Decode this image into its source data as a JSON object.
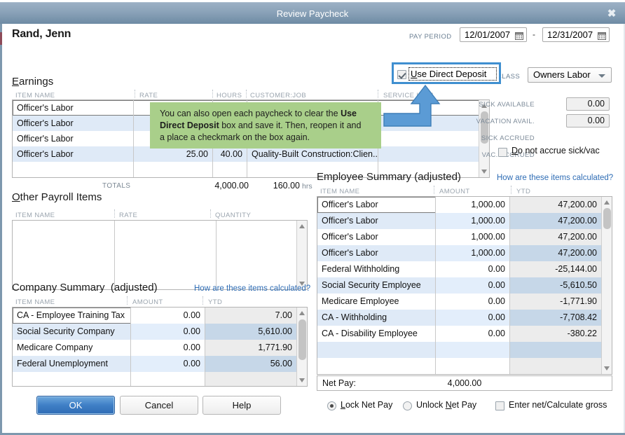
{
  "window": {
    "title": "Review Paycheck",
    "close_icon": "close-icon"
  },
  "header": {
    "employee_name": "Rand, Jenn",
    "pay_period_label": "PAY PERIOD",
    "pay_period_start": "12/01/2007",
    "pay_period_end": "12/31/2007",
    "date_separator": "-",
    "class_label": "CLASS",
    "class_value": "Owners Labor",
    "direct_deposit_label_1": "U",
    "direct_deposit_label_2": "se Direct Deposit",
    "direct_deposit_checked": true
  },
  "callout": {
    "line1_a": "You can also open each paycheck to clear the ",
    "line1_b": "Use",
    "line2_a": "Direct Deposit",
    "line2_b": " box and save it. Then, reopen it and",
    "line3": "a place a checkmark on the box again."
  },
  "earnings": {
    "title_accel": "E",
    "title_rest": "arnings",
    "columns": [
      "ITEM NAME",
      "RATE",
      "HOURS",
      "CUSTOMER:JOB",
      "SERVICE ITEM"
    ],
    "rows": [
      {
        "item": "Officer's Labor",
        "rate": "",
        "hours": "",
        "customer_job": "",
        "service_item": ""
      },
      {
        "item": "Officer's Labor",
        "rate": "",
        "hours": "",
        "customer_job": "",
        "service_item": ""
      },
      {
        "item": "Officer's Labor",
        "rate": "",
        "hours": "",
        "customer_job": "",
        "service_item": ""
      },
      {
        "item": "Officer's Labor",
        "rate": "25.00",
        "hours": "40.00",
        "customer_job": "Quality-Built Construction:Clien...",
        "service_item": ""
      },
      {
        "item": "",
        "rate": "",
        "hours": "",
        "customer_job": "",
        "service_item": ""
      }
    ],
    "totals_label": "TOTALS",
    "totals_rate": "4,000.00",
    "totals_hours": "160.00",
    "totals_hours_unit": "hrs"
  },
  "leave_info": {
    "sick_available_label": "SICK AVAILABLE",
    "sick_available_value": "0.00",
    "vacation_avail_label": "VACATION AVAIL.",
    "vacation_avail_value": "0.00",
    "sick_accrued_label": "SICK ACCRUED",
    "vac_accrued_label": "VAC. ACCRUED",
    "do_not_accrue_accel": "D",
    "do_not_accrue_rest": "o not accrue sick/vac",
    "do_not_accrue_checked": false
  },
  "other_payroll": {
    "title_accel": "O",
    "title_rest": "ther Payroll Items",
    "columns": [
      "ITEM NAME",
      "RATE",
      "QUANTITY"
    ],
    "rows": []
  },
  "company_summary": {
    "title": "Company Summary",
    "title_suffix": "(adjusted)",
    "help_link": "How are these items calculated?",
    "columns": [
      "ITEM NAME",
      "AMOUNT",
      "YTD"
    ],
    "rows": [
      {
        "item": "CA - Employee Training Tax",
        "amount": "0.00",
        "ytd": "7.00"
      },
      {
        "item": "Social Security Company",
        "amount": "0.00",
        "ytd": "5,610.00"
      },
      {
        "item": "Medicare Company",
        "amount": "0.00",
        "ytd": "1,771.90"
      },
      {
        "item": "Federal Unemployment",
        "amount": "0.00",
        "ytd": "56.00"
      },
      {
        "item": "",
        "amount": "",
        "ytd": ""
      }
    ]
  },
  "employee_summary": {
    "title": "Employee Summary",
    "title_suffix": "(adjusted)",
    "help_link": "How are these items calculated?",
    "columns": [
      "ITEM NAME",
      "AMOUNT",
      "YTD"
    ],
    "rows": [
      {
        "item": "Officer's Labor",
        "amount": "1,000.00",
        "ytd": "47,200.00"
      },
      {
        "item": "Officer's Labor",
        "amount": "1,000.00",
        "ytd": "47,200.00"
      },
      {
        "item": "Officer's Labor",
        "amount": "1,000.00",
        "ytd": "47,200.00"
      },
      {
        "item": "Officer's Labor",
        "amount": "1,000.00",
        "ytd": "47,200.00"
      },
      {
        "item": "Federal Withholding",
        "amount": "0.00",
        "ytd": "-25,144.00"
      },
      {
        "item": "Social Security Employee",
        "amount": "0.00",
        "ytd": "-5,610.50"
      },
      {
        "item": "Medicare Employee",
        "amount": "0.00",
        "ytd": "-1,771.90"
      },
      {
        "item": "CA - Withholding",
        "amount": "0.00",
        "ytd": "-7,708.42"
      },
      {
        "item": "CA - Disability Employee",
        "amount": "0.00",
        "ytd": "-380.22"
      },
      {
        "item": "",
        "amount": "",
        "ytd": ""
      },
      {
        "item": "",
        "amount": "",
        "ytd": ""
      }
    ],
    "net_pay_label": "Net Pay:",
    "net_pay_value": "4,000.00"
  },
  "footer": {
    "ok_label": "OK",
    "cancel_label": "Cancel",
    "help_label": "Help",
    "lock_net_pay_accel": "L",
    "lock_net_pay_rest": "ock Net Pay",
    "lock_selected": true,
    "unlock_net_pay_a": "Unlock ",
    "unlock_net_pay_accel": "N",
    "unlock_net_pay_rest": "et Pay",
    "unlock_selected": false,
    "enter_net_a": "Enter net/Calculate ",
    "enter_net_accel": "g",
    "enter_net_rest": "ross",
    "enter_net_checked": false
  },
  "colors": {
    "title_bar": "#8aa2b8",
    "accent_blue": "#3f8fd0",
    "callout_green": "#a9cf8a",
    "link_blue": "#2f6db5",
    "row_alt": "#dfeaf7"
  }
}
